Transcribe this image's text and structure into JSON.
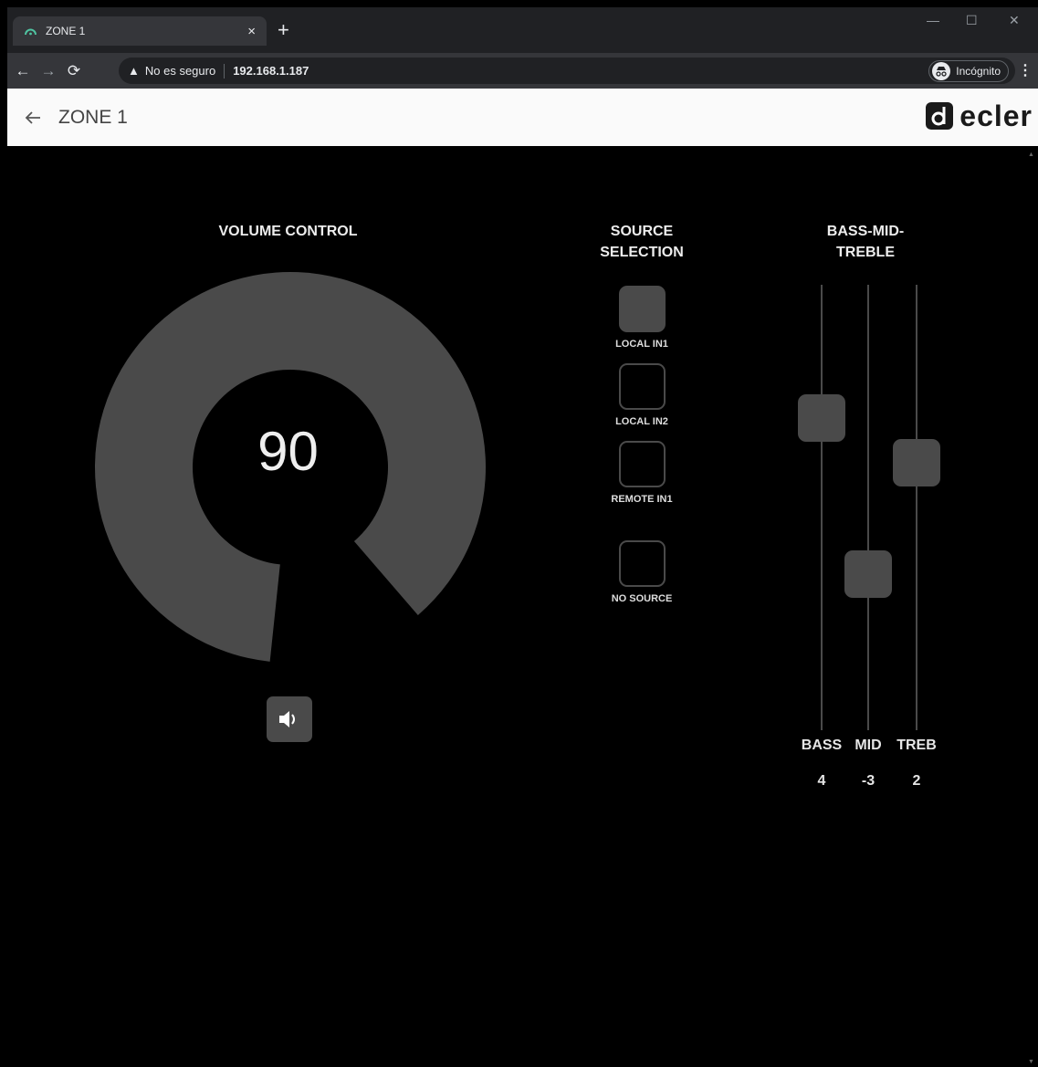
{
  "browser": {
    "tab_title": "ZONE 1",
    "close_tab": "×",
    "new_tab": "+",
    "security_label": "No es seguro",
    "url": "192.168.1.187",
    "incognito_label": "Incógnito"
  },
  "appbar": {
    "title": "ZONE 1",
    "brand": "ecler"
  },
  "volume": {
    "header": "VOLUME CONTROL",
    "value": "90",
    "level": 90
  },
  "source": {
    "header_line1": "SOURCE",
    "header_line2": "SELECTION",
    "items": [
      {
        "label": "LOCAL IN1",
        "active": true
      },
      {
        "label": "LOCAL IN2",
        "active": false
      },
      {
        "label": "REMOTE IN1",
        "active": false
      },
      {
        "label": "NO SOURCE",
        "active": false
      }
    ]
  },
  "eq": {
    "header_line1": "BASS-MID-",
    "header_line2": "TREBLE",
    "bands": [
      {
        "label": "BASS",
        "value": "4",
        "level": 4
      },
      {
        "label": "MID",
        "value": "-3",
        "level": -3
      },
      {
        "label": "TREB",
        "value": "2",
        "level": 2
      }
    ],
    "range": [
      -10,
      10
    ]
  },
  "colors": {
    "control_gray": "#4a4a4a",
    "background": "#000000",
    "appbar": "#fafafa"
  }
}
